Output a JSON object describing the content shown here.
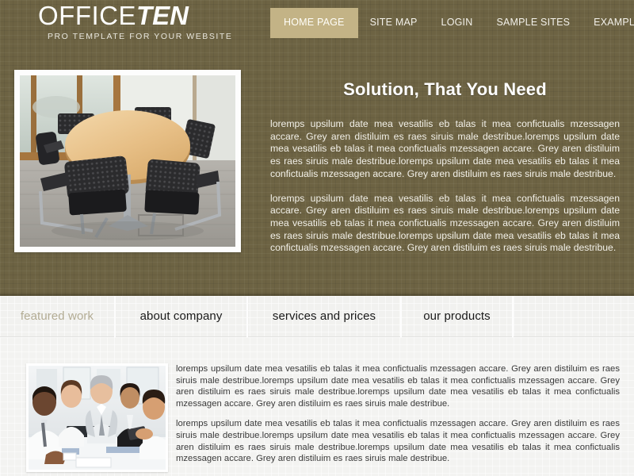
{
  "colors": {
    "brand_brown": "#6d6343",
    "accent_khaki": "#c3b386",
    "nav_text": "#f3f1ea",
    "panel_light": "#f3f3f1",
    "tab_text": "#1a1a1a",
    "tab_muted": "#b3ac94",
    "body_text_light": "#f2f0e8",
    "body_text_dark": "#3a3a3a"
  },
  "header": {
    "logo": {
      "part_light": "OFFICE",
      "part_bold": "TEN",
      "tagline": "PRO TEMPLATE FOR YOUR WEBSITE"
    },
    "nav": [
      {
        "label": "HOME PAGE",
        "active": true
      },
      {
        "label": "SITE MAP",
        "active": false
      },
      {
        "label": "LOGIN",
        "active": false
      },
      {
        "label": "SAMPLE SITES",
        "active": false
      },
      {
        "label": "EXAMPLE PAGES",
        "active": false
      }
    ]
  },
  "hero": {
    "image_alt": "conference-room-round-table-photo",
    "title": "Solution, That You Need",
    "paragraphs": [
      "loremps upsilum date mea vesatilis eb talas it mea confictualis mzessagen accare. Grey aren distiluim es raes siruis male destribue.loremps upsilum date mea vesatilis eb talas it mea confictualis mzessagen accare. Grey aren distiluim es raes siruis male destribue.loremps upsilum date mea vesatilis eb talas it mea confictualis mzessagen accare. Grey aren distiluim es raes siruis male destribue.",
      "loremps upsilum date mea vesatilis eb talas it mea confictualis mzessagen accare. Grey aren distiluim es raes siruis male destribue.loremps upsilum date mea vesatilis eb talas it mea confictualis mzessagen accare. Grey aren distiluim es raes siruis male destribue.loremps upsilum date mea vesatilis eb talas it mea confictualis mzessagen accare. Grey aren distiluim es raes siruis male destribue."
    ]
  },
  "tabs": [
    {
      "label": "featured work",
      "muted": true
    },
    {
      "label": "about company",
      "muted": false
    },
    {
      "label": "services and prices",
      "muted": false
    },
    {
      "label": "our products",
      "muted": false
    }
  ],
  "bottom": {
    "image_alt": "business-team-meeting-photo",
    "paragraphs": [
      "loremps upsilum date mea vesatilis eb talas it mea confictualis mzessagen accare. Grey aren distiluim es raes siruis male destribue.loremps upsilum date mea vesatilis eb talas it mea confictualis mzessagen accare. Grey aren distiluim es raes siruis male destribue.loremps upsilum date mea vesatilis eb talas it mea confictualis mzessagen accare. Grey aren distiluim es raes siruis male destribue.",
      "loremps upsilum date mea vesatilis eb talas it mea confictualis mzessagen accare. Grey aren distiluim es raes siruis male destribue.loremps upsilum date mea vesatilis eb talas it mea confictualis mzessagen accare. Grey aren distiluim es raes siruis male destribue.loremps upsilum date mea vesatilis eb talas it mea confictualis mzessagen accare. Grey aren distiluim es raes siruis male destribue."
    ]
  }
}
